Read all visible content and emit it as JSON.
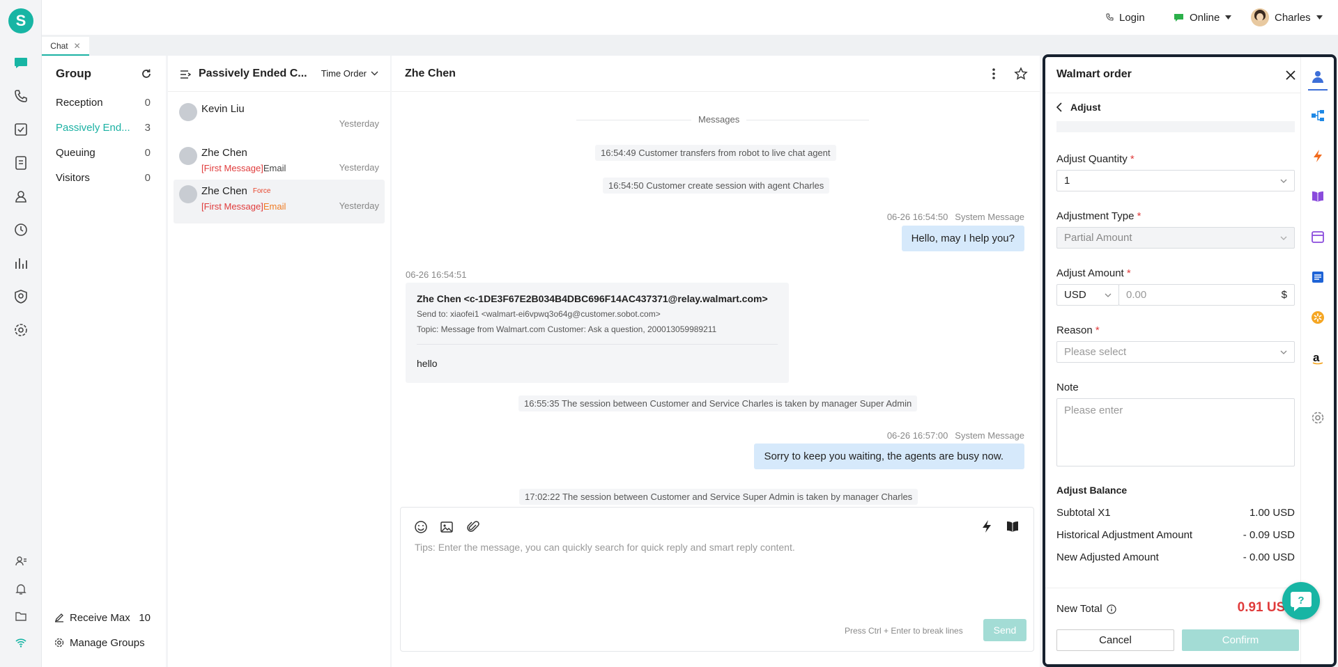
{
  "topbar": {
    "login": "Login",
    "status": "Online",
    "user": "Charles"
  },
  "tabs": [
    {
      "label": "Chat"
    }
  ],
  "group_panel": {
    "title": "Group",
    "items": [
      {
        "label": "Reception",
        "count": "0"
      },
      {
        "label": "Passively End...",
        "count": "3"
      },
      {
        "label": "Queuing",
        "count": "0"
      },
      {
        "label": "Visitors",
        "count": "0"
      }
    ],
    "receive_max_label": "Receive Max",
    "receive_max_value": "10",
    "manage_groups": "Manage Groups"
  },
  "session_list": {
    "title": "Passively Ended C...",
    "sort": "Time Order",
    "sessions": [
      {
        "name": "Kevin Liu",
        "badge": "",
        "first": "",
        "channel": "",
        "time": "Yesterday"
      },
      {
        "name": "Zhe Chen",
        "badge": "",
        "first": "[First Message]",
        "channel": "Email",
        "time": "Yesterday"
      },
      {
        "name": "Zhe Chen",
        "badge": "Force",
        "first": "[First Message]",
        "channel": "Email",
        "time": "Yesterday"
      }
    ]
  },
  "chat": {
    "title": "Zhe Chen",
    "divider": "Messages",
    "sys1": "16:54:49 Customer transfers from robot to live chat agent",
    "sys2": "16:54:50 Customer create session with agent Charles",
    "msg1_time": "06-26 16:54:50",
    "msg1_sender": "System Message",
    "msg1_text": "Hello, may I help you?",
    "email_time": "06-26 16:54:51",
    "email_from": "Zhe Chen <c-1DE3F67E2B034B4DBC696F14AC437371@relay.walmart.com>",
    "email_to": "Send to: xiaofei1 <walmart-ei6vpwq3o64g@customer.sobot.com>",
    "email_topic": "Topic: Message from Walmart.com Customer:  Ask a question, 200013059989211",
    "email_body": "hello",
    "sys3": "16:55:35 The session between Customer and Service Charles is taken by manager Super Admin",
    "msg2_time": "06-26 16:57:00",
    "msg2_sender": "System Message",
    "msg2_text": "Sorry to keep you waiting, the agents are busy now.",
    "sys4": "17:02:22 The session between Customer and Service Super Admin is taken by manager Charles",
    "composer_placeholder": "Tips: Enter the message, you can quickly search for quick reply and smart reply content.",
    "hint": "Press Ctrl + Enter to break lines",
    "send": "Send"
  },
  "order_panel": {
    "title": "Walmart order",
    "back_label": "Adjust",
    "qty_label": "Adjust Quantity",
    "qty_value": "1",
    "type_label": "Adjustment Type",
    "type_value": "Partial Amount",
    "amount_label": "Adjust Amount",
    "currency": "USD",
    "amount_placeholder": "0.00",
    "amount_suffix": "$",
    "reason_label": "Reason",
    "reason_placeholder": "Please select",
    "note_label": "Note",
    "note_placeholder": "Please enter",
    "balance_title": "Adjust Balance",
    "rows": [
      {
        "label": "Subtotal X1",
        "value": "1.00 USD"
      },
      {
        "label": "Historical Adjustment Amount",
        "value": "- 0.09 USD"
      },
      {
        "label": "New Adjusted Amount",
        "value": "- 0.00 USD"
      }
    ],
    "total_label": "New Total",
    "total_value": "0.91 USD",
    "cancel": "Cancel",
    "confirm": "Confirm",
    "required_mark": "*"
  },
  "colors": {
    "brand": "#17b5a4",
    "accent_text": "#1bb1a3",
    "bubble": "#d6e9fb",
    "danger": "#e03b3b",
    "email_orange": "#f07c24"
  }
}
